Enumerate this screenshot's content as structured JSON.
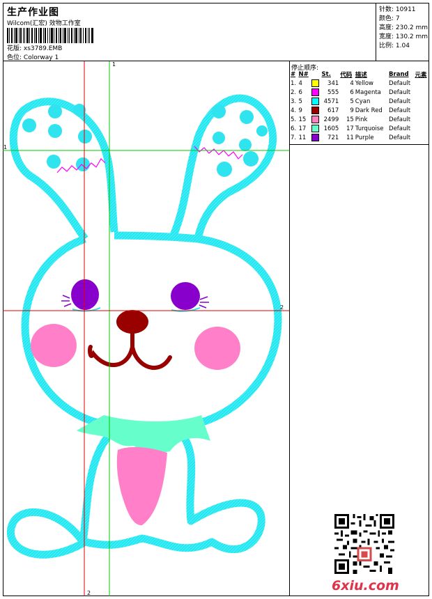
{
  "header": {
    "title": "生产作业图",
    "company": "Wilcom(汇宏) 效物工作室",
    "design_label": "花版:",
    "design_file": "xs3789.EMB",
    "colorway_label": "色位:",
    "colorway": "Colorway 1"
  },
  "stats": {
    "stitches": "针数: 10911",
    "colors": "颜色: 7",
    "height": "高度: 230.2 mm",
    "width": "宽度: 130.2 mm",
    "scale": "比例: 1.04"
  },
  "guides": {
    "v1": "1",
    "v2": "2",
    "h1": "1",
    "h2": "2"
  },
  "sequence": {
    "title": "停止顺序:",
    "headers": [
      "#",
      "N#",
      "St.",
      "代码",
      "描述",
      "Brand",
      "元素"
    ],
    "rows": [
      {
        "idx": "1.",
        "n": "4",
        "st": "341",
        "code": "4",
        "desc": "Yellow",
        "brand": "Default",
        "color": "#ffff00"
      },
      {
        "idx": "2.",
        "n": "6",
        "st": "555",
        "code": "6",
        "desc": "Magenta",
        "brand": "Default",
        "color": "#ff00ff"
      },
      {
        "idx": "3.",
        "n": "5",
        "st": "4571",
        "code": "5",
        "desc": "Cyan",
        "brand": "Default",
        "color": "#00ffff"
      },
      {
        "idx": "4.",
        "n": "9",
        "st": "617",
        "code": "9",
        "desc": "Dark Red",
        "brand": "Default",
        "color": "#990000"
      },
      {
        "idx": "5.",
        "n": "15",
        "st": "2499",
        "code": "15",
        "desc": "Pink",
        "brand": "Default",
        "color": "#ff80c0"
      },
      {
        "idx": "6.",
        "n": "17",
        "st": "1605",
        "code": "17",
        "desc": "Turquoise",
        "brand": "Default",
        "color": "#66ffcc"
      },
      {
        "idx": "7.",
        "n": "11",
        "st": "721",
        "code": "11",
        "desc": "Purple",
        "brand": "Default",
        "color": "#8800cc"
      }
    ]
  },
  "watermark": "6xiu.com"
}
